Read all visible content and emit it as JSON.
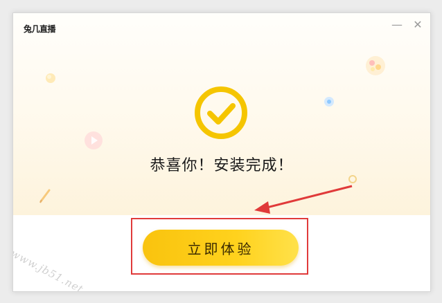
{
  "window": {
    "logo_text": "兔几直播",
    "minimize_glyph": "—",
    "close_glyph": "✕"
  },
  "main": {
    "success_icon": "check-circle-icon",
    "headline": "恭喜你！安装完成！",
    "cta_label": "立即体验"
  },
  "annotation": {
    "highlight_color": "#e03a3a",
    "watermark": "www.jb51.net"
  },
  "colors": {
    "accent": "#ffd21d",
    "check": "#f5c500"
  }
}
